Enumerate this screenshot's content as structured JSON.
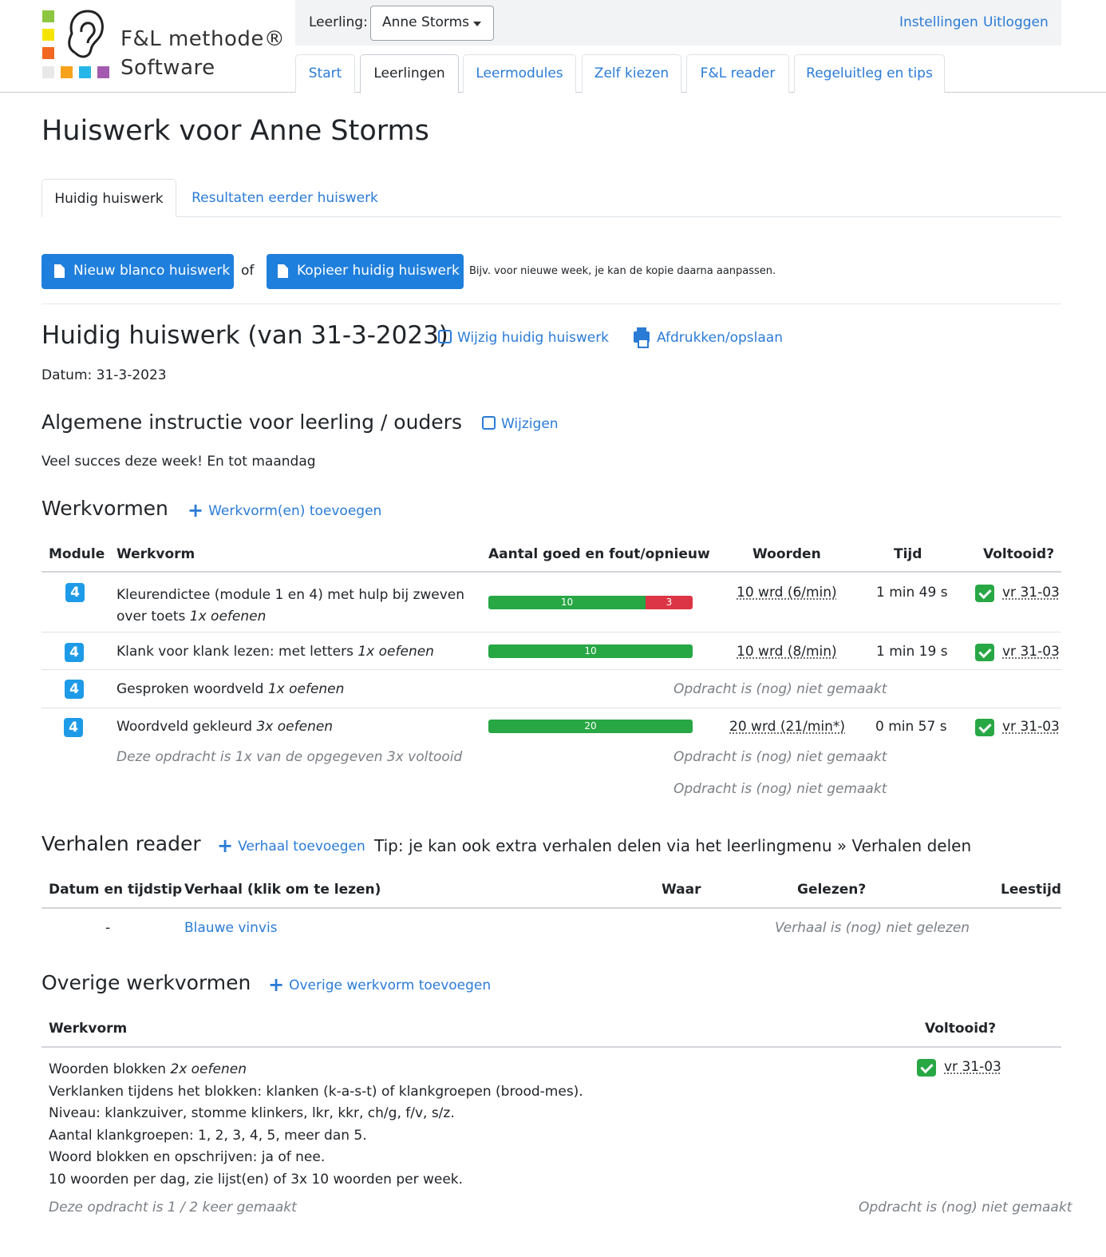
{
  "logo": {
    "line1": "F&L methode®",
    "line2": "Software"
  },
  "topbar": {
    "student_label": "Leerling:",
    "student_value": "Anne Storms",
    "settings": "Instellingen",
    "logout": "Uitloggen"
  },
  "nav": {
    "start": "Start",
    "leerlingen": "Leerlingen",
    "leermodules": "Leermodules",
    "zelf": "Zelf kiezen",
    "reader": "F&L reader",
    "regel": "Regeluitleg en tips"
  },
  "page": {
    "title": "Huiswerk voor Anne Storms",
    "tab_current": "Huidig huiswerk",
    "tab_results": "Resultaten eerder huiswerk",
    "btn_new": "Nieuw blanco huiswerk",
    "or": "of",
    "btn_copy": "Kopieer huidig huiswerk",
    "copy_hint": "Bijv. voor nieuwe week, je kan de kopie daarna aanpassen."
  },
  "current": {
    "title": "Huidig huiswerk (van 31-3-2023)",
    "edit": "Wijzig huidig huiswerk",
    "print": "Afdrukken/opslaan",
    "date": "Datum: 31-3-2023"
  },
  "instruction": {
    "title": "Algemene instructie voor leerling / ouders",
    "edit": "Wijzigen",
    "text": "Veel succes deze week! En tot maandag"
  },
  "werkvormen": {
    "title": "Werkvormen",
    "add": "Werkvorm(en) toevoegen",
    "headers": {
      "module": "Module",
      "werkvorm": "Werkvorm",
      "score": "Aantal goed en fout/opnieuw",
      "woorden": "Woorden",
      "tijd": "Tijd",
      "voltooid": "Voltooid?"
    },
    "rows": [
      {
        "module": "4",
        "name1": "Kleurendictee (module 1 en 4) met hulp bij zweven",
        "name2": "over toets",
        "reps": "1x oefenen",
        "good": 10,
        "bad": 3,
        "good_label": "10",
        "bad_label": "3",
        "words": "10 wrd (6/min)",
        "time": "1 min 49 s",
        "done": "vr 31-03"
      },
      {
        "module": "4",
        "name": "Klank voor klank lezen: met letters",
        "reps": "1x oefenen",
        "good": 10,
        "bad": 0,
        "good_label": "10",
        "words": "10 wrd (8/min)",
        "time": "1 min 19 s",
        "done": "vr 31-03"
      },
      {
        "module": "4",
        "name": "Gesproken woordveld",
        "reps": "1x oefenen",
        "status": "Opdracht is (nog) niet gemaakt"
      },
      {
        "module": "4",
        "name": "Woordveld gekleurd",
        "reps": "3x oefenen",
        "good": 20,
        "bad": 0,
        "good_label": "20",
        "words": "20 wrd (21/min*)",
        "time": "0 min 57 s",
        "done": "vr 31-03",
        "note": "Deze opdracht is 1x van de opgegeven 3x voltooid",
        "status2": "Opdracht is (nog) niet gemaakt",
        "status3": "Opdracht is (nog) niet gemaakt"
      }
    ]
  },
  "verhalen": {
    "title": "Verhalen reader",
    "add": "Verhaal toevoegen",
    "tip": "Tip: je kan ook extra verhalen delen via het leerlingmenu » Verhalen delen",
    "headers": {
      "datum": "Datum en tijdstip",
      "verhaal": "Verhaal (klik om te lezen)",
      "waar": "Waar",
      "gelezen": "Gelezen?",
      "leestijd": "Leestijd"
    },
    "row": {
      "datum": "-",
      "verhaal": "Blauwe vinvis",
      "status": "Verhaal is (nog) niet gelezen"
    }
  },
  "overige": {
    "title": "Overige werkvormen",
    "add": "Overige werkvorm toevoegen",
    "headers": {
      "werkvorm": "Werkvorm",
      "voltooid": "Voltooid?"
    },
    "name": "Woorden blokken",
    "reps": "2x oefenen",
    "lines": [
      "Verklanken tijdens het blokken: klanken (k-a-s-t) of klankgroepen (brood-mes).",
      "Niveau: klankzuiver, stomme klinkers, lkr, kkr, ch/g, f/v, s/z.",
      "Aantal klankgroepen: 1, 2, 3, 4, 5, meer dan 5.",
      "Woord blokken en opschrijven: ja of nee.",
      "10 woorden per dag, zie lijst(en) of 3x 10 woorden per week."
    ],
    "done": "vr 31-03",
    "note": "Deze opdracht is 1 / 2 keer gemaakt",
    "status": "Opdracht is (nog) niet gemaakt"
  },
  "colors": {
    "accent": "#2a7bd6",
    "button": "#1f7fdc",
    "good": "#28a745",
    "bad": "#dc3545",
    "badge": "#1e9be8"
  }
}
